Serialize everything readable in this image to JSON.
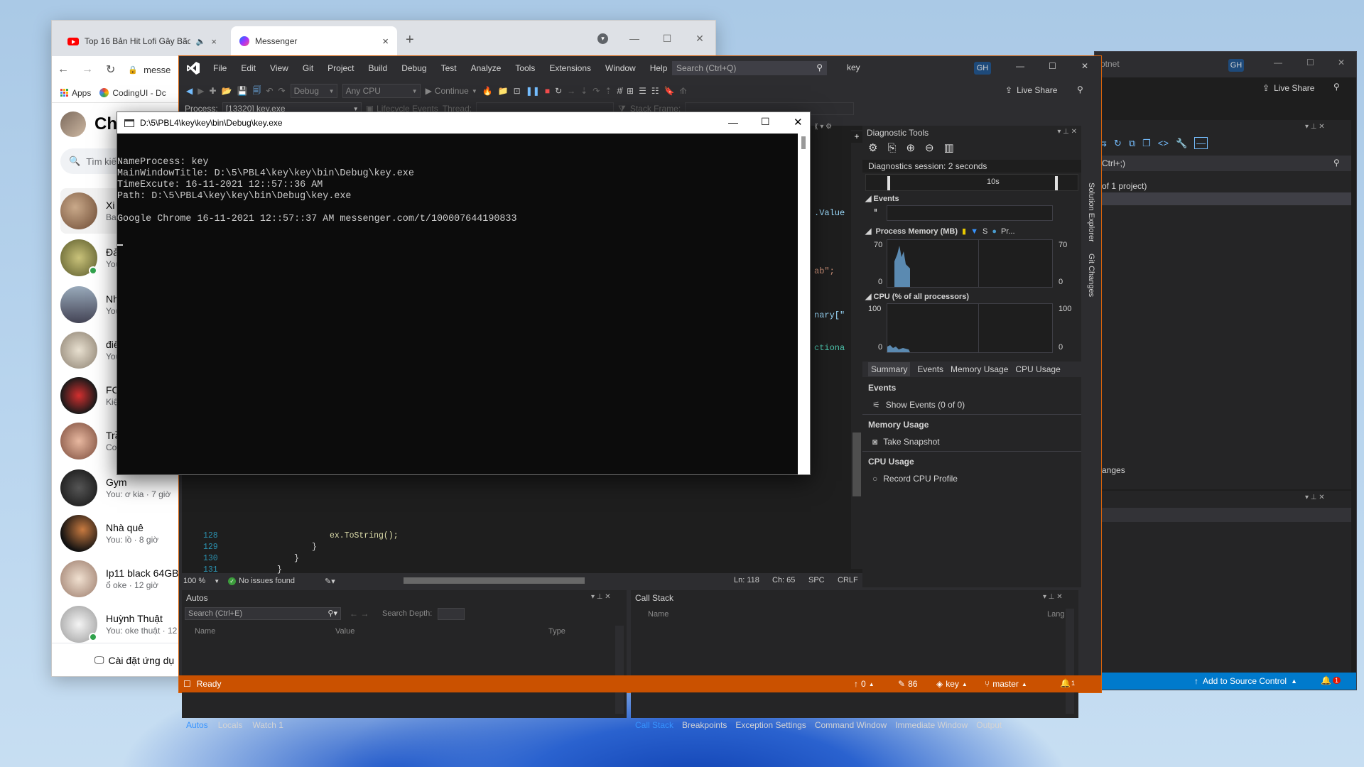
{
  "chrome": {
    "tabs": [
      {
        "label": "Top 16 Bản Hit Lofi Gây Bão"
      },
      {
        "label": "Messenger"
      }
    ],
    "url": "messe",
    "bookmarks": [
      {
        "label": "Apps"
      },
      {
        "label": "CodingUI - Dc"
      }
    ],
    "messenger": {
      "header": "Cha",
      "search_placeholder": "Tìm kiế",
      "chats": [
        {
          "name": "Xi",
          "sub": "Ba"
        },
        {
          "name": "Đả",
          "sub": "You"
        },
        {
          "name": "Nh",
          "sub": "You"
        },
        {
          "name": "điể",
          "sub": "You"
        },
        {
          "name": "FC",
          "sub": "Kiệ"
        },
        {
          "name": "Trầ",
          "sub": "Co"
        },
        {
          "name": "Gym",
          "sub": "You: ơ kia · 7 giờ"
        },
        {
          "name": "Nhà quê",
          "sub": "You: lồ · 8 giờ"
        },
        {
          "name": "Ip11 black 64GB",
          "sub": "ổ oke · 12 giờ"
        },
        {
          "name": "Huỳnh Thuật",
          "sub": "You: oke thuật · 12 g"
        }
      ],
      "install_app": "Cài đặt ứng dụ"
    }
  },
  "vs": {
    "menu": [
      "File",
      "Edit",
      "View",
      "Git",
      "Project",
      "Build",
      "Debug",
      "Test",
      "Analyze",
      "Tools",
      "Extensions",
      "Window",
      "Help"
    ],
    "search_placeholder": "Search (Ctrl+Q)",
    "solution_name": "key",
    "avatar_initials": "GH",
    "live_share": "Live Share",
    "config": "Debug",
    "platform": "Any CPU",
    "continue_label": "Continue",
    "process_label": "Process:",
    "process_value": "[13320] key.exe",
    "lifecycle": "Lifecycle Events",
    "thread_label": "Thread:",
    "stack_frame_label": "Stack Frame:",
    "code_fragments": [
      ".Value",
      "ab\";",
      "nary[\"",
      "ctiona"
    ],
    "code_lines": [
      {
        "num": "128",
        "text": "ex.ToString();"
      },
      {
        "num": "129",
        "text": "}"
      },
      {
        "num": "130",
        "text": "}"
      },
      {
        "num": "131",
        "text": "}"
      }
    ],
    "editor_status": {
      "zoom": "100 %",
      "issues": "No issues found",
      "ln": "Ln: 118",
      "ch": "Ch: 65",
      "spc": "SPC",
      "crlf": "CRLF"
    },
    "diagnostics": {
      "title": "Diagnostic Tools",
      "session": "Diagnostics session: 2 seconds",
      "timeline_label": "10s",
      "events_label": "Events",
      "memory_label": "Process Memory (MB)",
      "memory_legend": [
        "S",
        "Pr..."
      ],
      "memory_max": "70",
      "memory_min": "0",
      "cpu_label": "CPU (% of all processors)",
      "cpu_max": "100",
      "cpu_min": "0",
      "tabs": [
        "Summary",
        "Events",
        "Memory Usage",
        "CPU Usage"
      ],
      "sections": [
        {
          "title": "Events",
          "action": "Show Events (0 of 0)"
        },
        {
          "title": "Memory Usage",
          "action": "Take Snapshot"
        },
        {
          "title": "CPU Usage",
          "action": "Record CPU Profile"
        }
      ]
    },
    "side_tabs": [
      "Solution Explorer",
      "Git Changes"
    ],
    "autos": {
      "title": "Autos",
      "search_placeholder": "Search (Ctrl+E)",
      "search_depth": "Search Depth:",
      "columns": [
        "Name",
        "Value",
        "Type"
      ],
      "tabs": [
        "Autos",
        "Locals",
        "Watch 1"
      ]
    },
    "callstack": {
      "title": "Call Stack",
      "columns": [
        "Name",
        "Lang"
      ],
      "tabs": [
        "Call Stack",
        "Breakpoints",
        "Exception Settings",
        "Command Window",
        "Immediate Window",
        "Output"
      ]
    },
    "status": {
      "ready": "Ready",
      "up": "0",
      "edits": "86",
      "repo": "key",
      "branch": "master",
      "notifications": "1"
    }
  },
  "vs2": {
    "title_fragment": "otnet",
    "avatar_initials": "GH",
    "live_share": "Live Share",
    "search_fragment": "Ctrl+;)",
    "project_fragment": "of 1 project)",
    "changes_fragment": "anges",
    "add_source": "Add to Source Control",
    "notifications": "1"
  },
  "console": {
    "title": "D:\\5\\PBL4\\key\\key\\bin\\Debug\\key.exe",
    "output": "NameProcess: key\nMainWindowTitle: D:\\5\\PBL4\\key\\key\\bin\\Debug\\key.exe\nTimeExcute: 16-11-2021 12::57::36 AM\nPath: D:\\5\\PBL4\\key\\key\\bin\\Debug\\key.exe\n\nGoogle Chrome 16-11-2021 12::57::37 AM messenger.com/t/100007644190833"
  }
}
